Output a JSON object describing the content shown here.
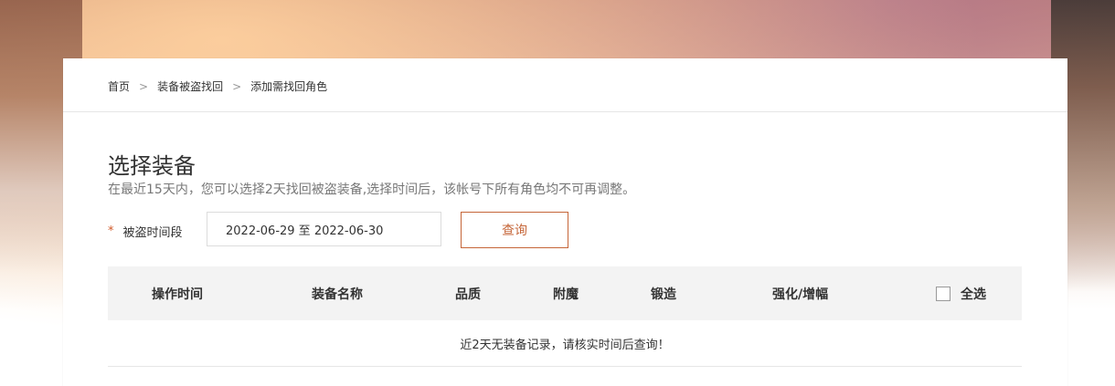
{
  "breadcrumb": {
    "items": [
      "首页",
      "装备被盗找回",
      "添加需找回角色"
    ],
    "separator": ">"
  },
  "section": {
    "title": "选择装备",
    "subtitle": "在最近15天内，您可以选择2天找回被盗装备,选择时间后，该帐号下所有角色均不可再调整。"
  },
  "filter": {
    "required_mark": "*",
    "label": "被盗时间段",
    "date_range": "2022-06-29 至 2022-06-30",
    "query_label": "查询"
  },
  "table": {
    "columns": [
      "操作时间",
      "装备名称",
      "品质",
      "附魔",
      "锻造",
      "强化/增幅"
    ],
    "select_all_label": "全选",
    "empty_message": "近2天无装备记录，请核实时间后查询！"
  },
  "colors": {
    "accent": "#c56538",
    "required": "#d05a2a",
    "header_bg": "#f3f3f3"
  }
}
